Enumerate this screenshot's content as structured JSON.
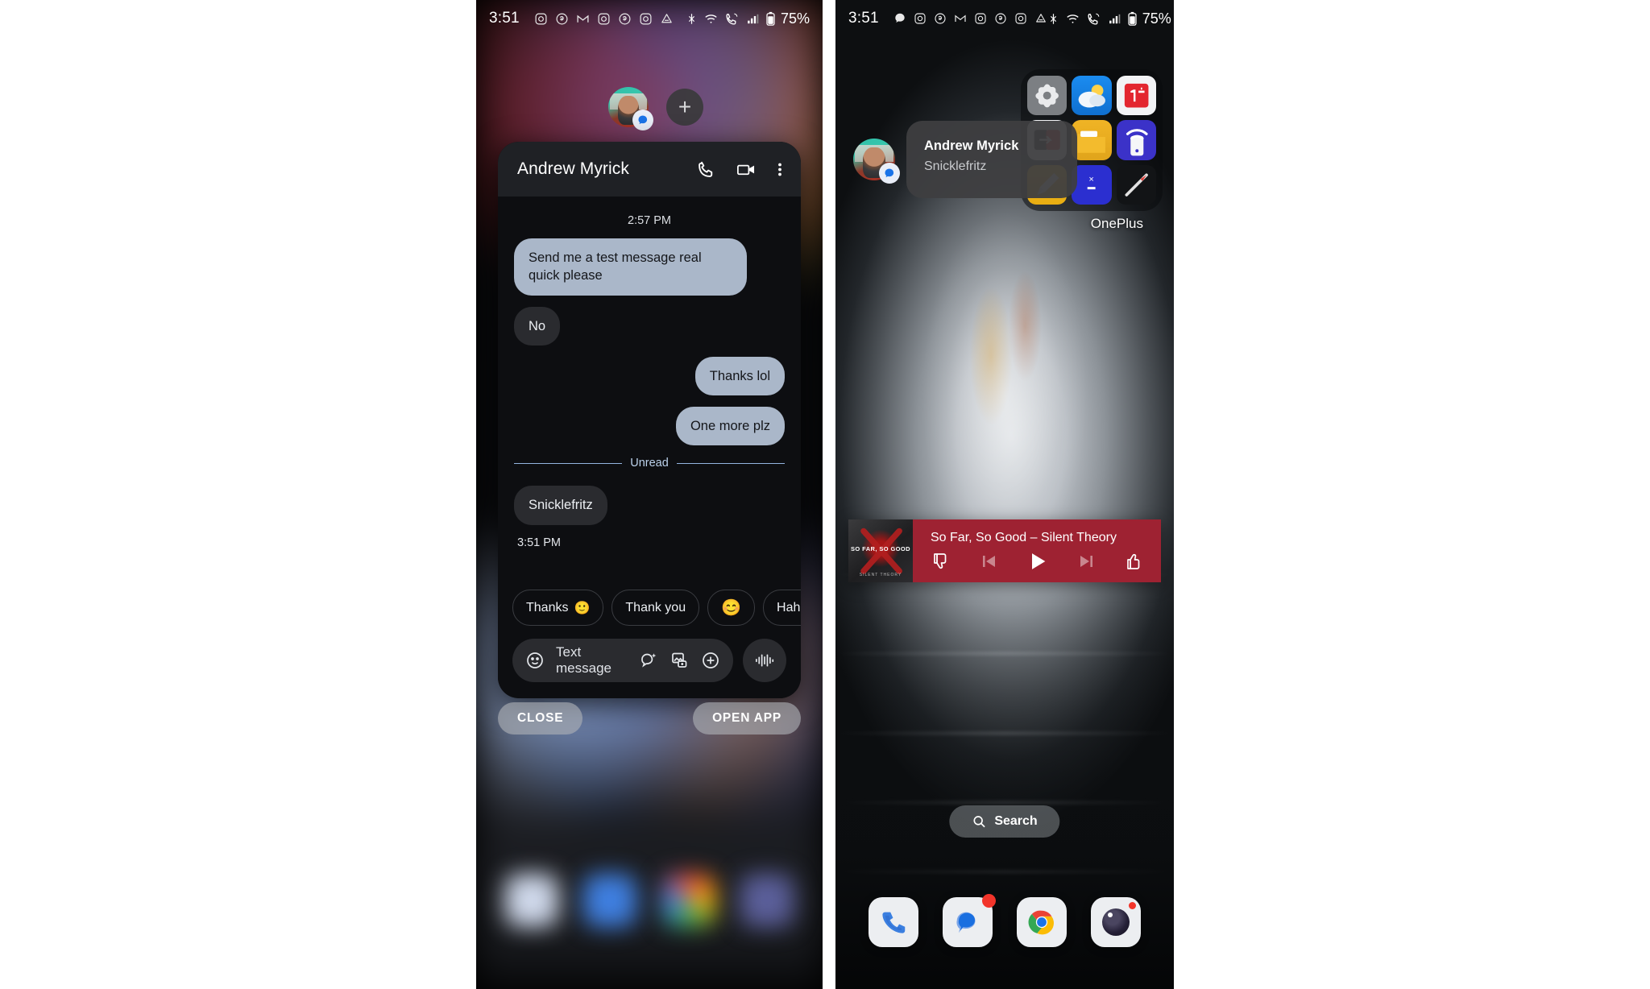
{
  "left_phone": {
    "status_bar": {
      "time": "3:51",
      "battery_text": "75%",
      "left_icons": [
        "instagram-icon",
        "threads-icon",
        "gmail-icon",
        "instagram-icon",
        "threads-icon",
        "instagram-icon",
        "authenticator-icon"
      ],
      "right_icons": [
        "bluetooth-icon",
        "wifi-icon",
        "wifi-calling-icon",
        "signal-icon",
        "battery-icon"
      ]
    },
    "bubble_bar": {
      "avatar_name": "Andrew Myrick",
      "avatar_badge_icon": "google-messages-icon",
      "add_bubble_label": "+"
    },
    "chat": {
      "title": "Andrew Myrick",
      "header_icons": [
        "call-icon",
        "video-call-icon",
        "more-vert-icon"
      ],
      "timestamp_top": "2:57 PM",
      "messages": [
        {
          "id": "m1",
          "side": "in",
          "style": "them",
          "text": "Send me a test message real quick please"
        },
        {
          "id": "m2",
          "side": "in",
          "style": "grey",
          "text": "No"
        },
        {
          "id": "m3",
          "side": "out",
          "style": "me",
          "text": "Thanks lol"
        },
        {
          "id": "m4",
          "side": "out",
          "style": "me",
          "text": "One more plz"
        }
      ],
      "unread_label": "Unread",
      "unread_messages": [
        {
          "id": "m5",
          "side": "in",
          "style": "grey",
          "text": "Snicklefritz"
        }
      ],
      "unread_timestamp": "3:51 PM",
      "suggestion_chips": [
        {
          "label": "Thanks",
          "emoji": "🙂"
        },
        {
          "label": "Thank you",
          "emoji": ""
        },
        {
          "label": "",
          "emoji": "😊"
        },
        {
          "label": "Haha",
          "emoji": ""
        }
      ],
      "compose": {
        "placeholder": "Text message",
        "value": "",
        "icons": [
          "emoji-icon",
          "smart-reply-icon",
          "gallery-icon",
          "plus-circle-icon",
          "voice-waveform-icon"
        ]
      }
    },
    "actions": {
      "close_label": "CLOSE",
      "open_app_label": "OPEN APP"
    }
  },
  "right_phone": {
    "status_bar": {
      "time": "3:51",
      "battery_text": "75%",
      "left_icons": [
        "chat-icon",
        "instagram-icon",
        "threads-icon",
        "gmail-icon",
        "instagram-icon",
        "threads-icon",
        "instagram-icon",
        "authenticator-icon"
      ],
      "right_icons": [
        "bluetooth-icon",
        "wifi-icon",
        "wifi-calling-icon",
        "signal-icon",
        "battery-icon"
      ]
    },
    "notification": {
      "sender": "Andrew Myrick",
      "preview": "Snicklefritz",
      "avatar_badge_icon": "google-messages-icon"
    },
    "folder": {
      "label": "OnePlus",
      "apps": [
        {
          "name": "settings-app-icon"
        },
        {
          "name": "weather-app-icon"
        },
        {
          "name": "oneplus-community-app-icon"
        },
        {
          "name": "clone-phone-app-icon"
        },
        {
          "name": "files-app-icon"
        },
        {
          "name": "switch-app-icon"
        },
        {
          "name": "notes-app-icon"
        },
        {
          "name": "calculator-app-icon"
        },
        {
          "name": "compass-app-icon"
        }
      ]
    },
    "media_player": {
      "title": "So Far, So Good",
      "separator": "–",
      "artist": "Silent Theory",
      "track_line": "So Far, So Good  –  Silent Theory",
      "album_art_title": "SO FAR, SO GOOD",
      "album_art_artist": "SILENT THEORY",
      "accent_color": "#9e2232",
      "controls": [
        "thumbs-down-icon",
        "previous-track-icon",
        "play-icon",
        "next-track-icon",
        "thumbs-up-icon"
      ],
      "is_playing": false
    },
    "search": {
      "label": "Search",
      "icon": "search-icon"
    },
    "dock": [
      {
        "name": "phone-app-icon",
        "badge": ""
      },
      {
        "name": "messages-app-icon",
        "badge": "dot"
      },
      {
        "name": "chrome-app-icon",
        "badge": ""
      },
      {
        "name": "camera-app-icon",
        "badge": "small-dot"
      }
    ]
  },
  "colors": {
    "bubble_them": "#aab7c9",
    "bubble_grey": "#2a2b2f",
    "unread_accent": "#93b4e0",
    "media_red": "#9e2232",
    "badge_red": "#f2342a"
  }
}
